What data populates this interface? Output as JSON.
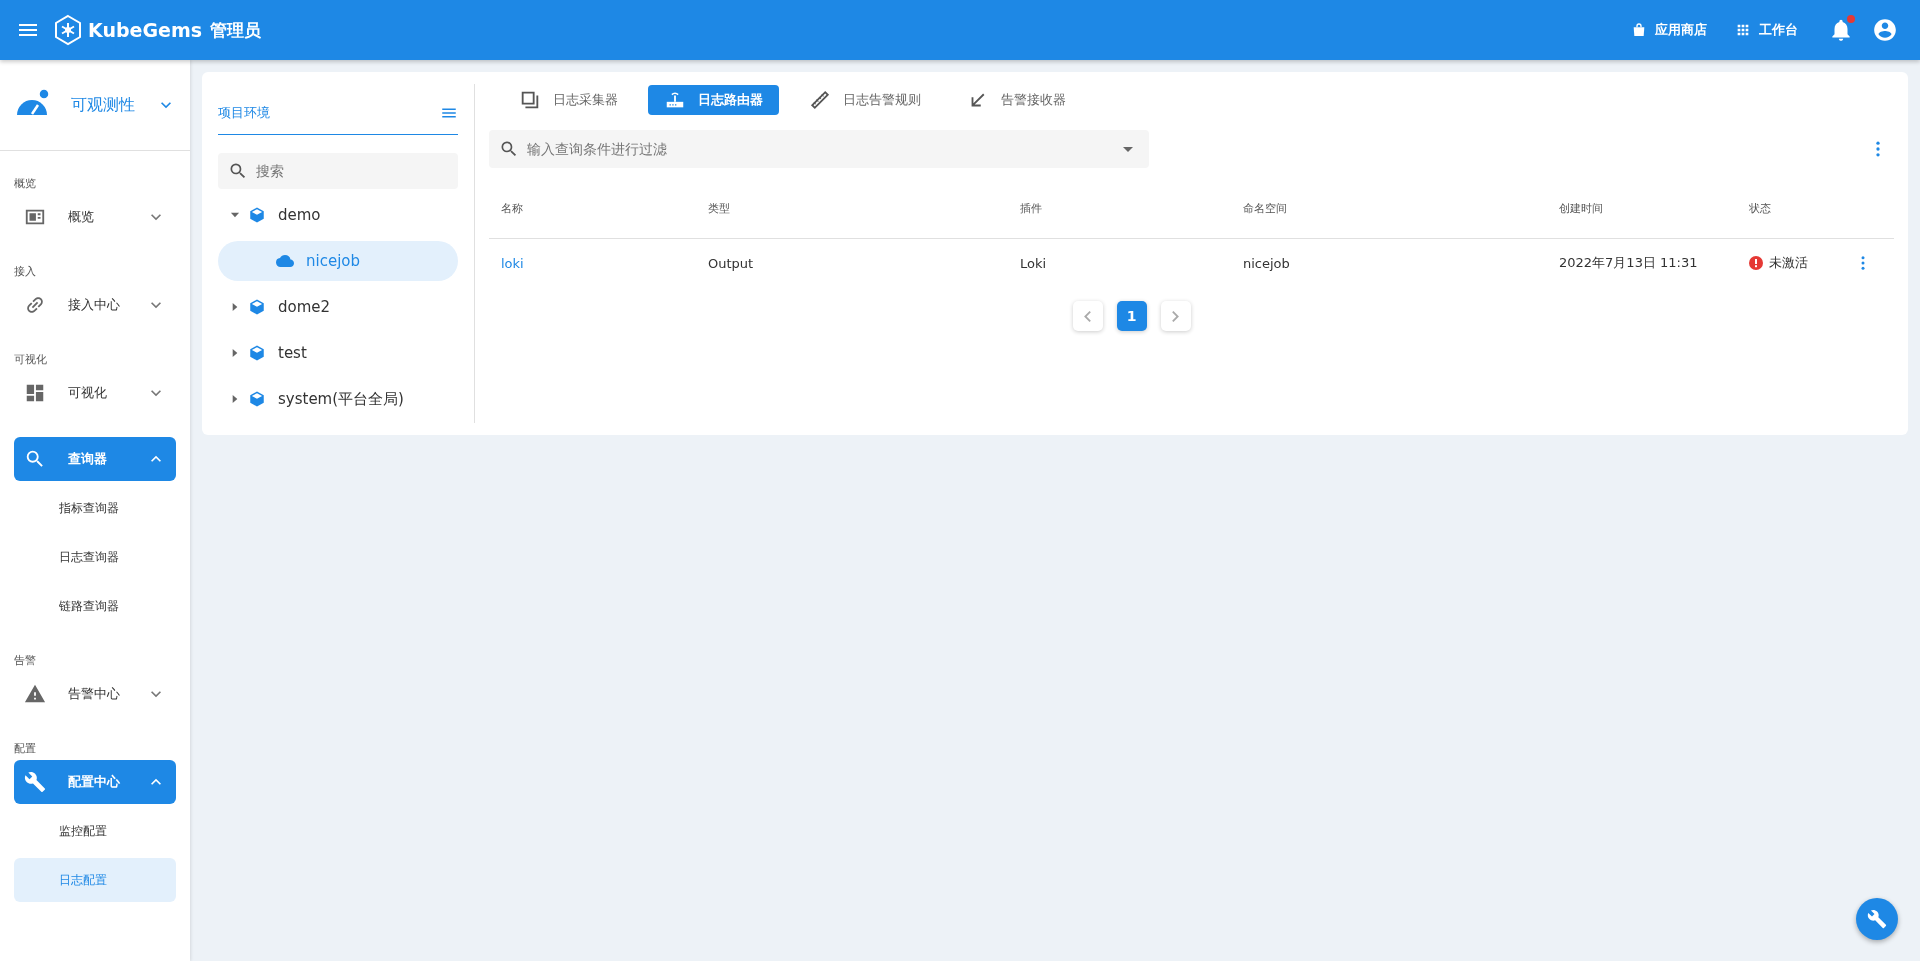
{
  "header": {
    "brand": "KubeGems",
    "role": "管理员",
    "actions": [
      {
        "label": "应用商店"
      },
      {
        "label": "工作台"
      }
    ],
    "notifications_unread": true
  },
  "sidebar": {
    "module": "可观测性",
    "groups": [
      {
        "label": "概览",
        "items": [
          {
            "label": "概览",
            "expanded": false
          }
        ]
      },
      {
        "label": "接入",
        "items": [
          {
            "label": "接入中心",
            "expanded": false
          }
        ]
      },
      {
        "label": "可视化",
        "items": [
          {
            "label": "可视化",
            "expanded": false
          }
        ]
      },
      {
        "items": [
          {
            "label": "查询器",
            "expanded": true,
            "children": [
              {
                "label": "指标查询器",
                "selected": false
              },
              {
                "label": "日志查询器",
                "selected": false
              },
              {
                "label": "链路查询器",
                "selected": false
              }
            ]
          }
        ]
      },
      {
        "label": "告警",
        "items": [
          {
            "label": "告警中心",
            "expanded": false
          }
        ]
      },
      {
        "label": "配置",
        "items": [
          {
            "label": "配置中心",
            "expanded": true,
            "children": [
              {
                "label": "监控配置",
                "selected": false
              },
              {
                "label": "日志配置",
                "selected": true
              }
            ]
          }
        ]
      }
    ]
  },
  "env_panel": {
    "title": "项目环境",
    "search": {
      "placeholder": "搜索"
    },
    "tree": [
      {
        "label": "demo",
        "expanded": true,
        "selected": false,
        "children": [
          {
            "label": "nicejob",
            "selected": true
          }
        ]
      },
      {
        "label": "dome2",
        "expanded": false,
        "selected": false
      },
      {
        "label": "test",
        "expanded": false,
        "selected": false
      },
      {
        "label": "system(平台全局)",
        "expanded": false,
        "selected": false
      }
    ]
  },
  "tabs": [
    {
      "label": "日志采集器",
      "selected": false
    },
    {
      "label": "日志路由器",
      "selected": true
    },
    {
      "label": "日志告警规则",
      "selected": false
    },
    {
      "label": "告警接收器",
      "selected": false
    }
  ],
  "filter": {
    "placeholder": "输入查询条件进行过滤"
  },
  "table": {
    "columns": [
      "名称",
      "类型",
      "插件",
      "命名空间",
      "创建时间",
      "状态"
    ],
    "rows": [
      {
        "cells": [
          "loki",
          "Output",
          "Loki",
          "nicejob",
          "2022年7月13日 11:31"
        ],
        "status": {
          "label": "未激活",
          "kind": "error"
        }
      }
    ]
  },
  "pagination": {
    "pages": [
      {
        "label": "1",
        "selected": true
      }
    ]
  }
}
